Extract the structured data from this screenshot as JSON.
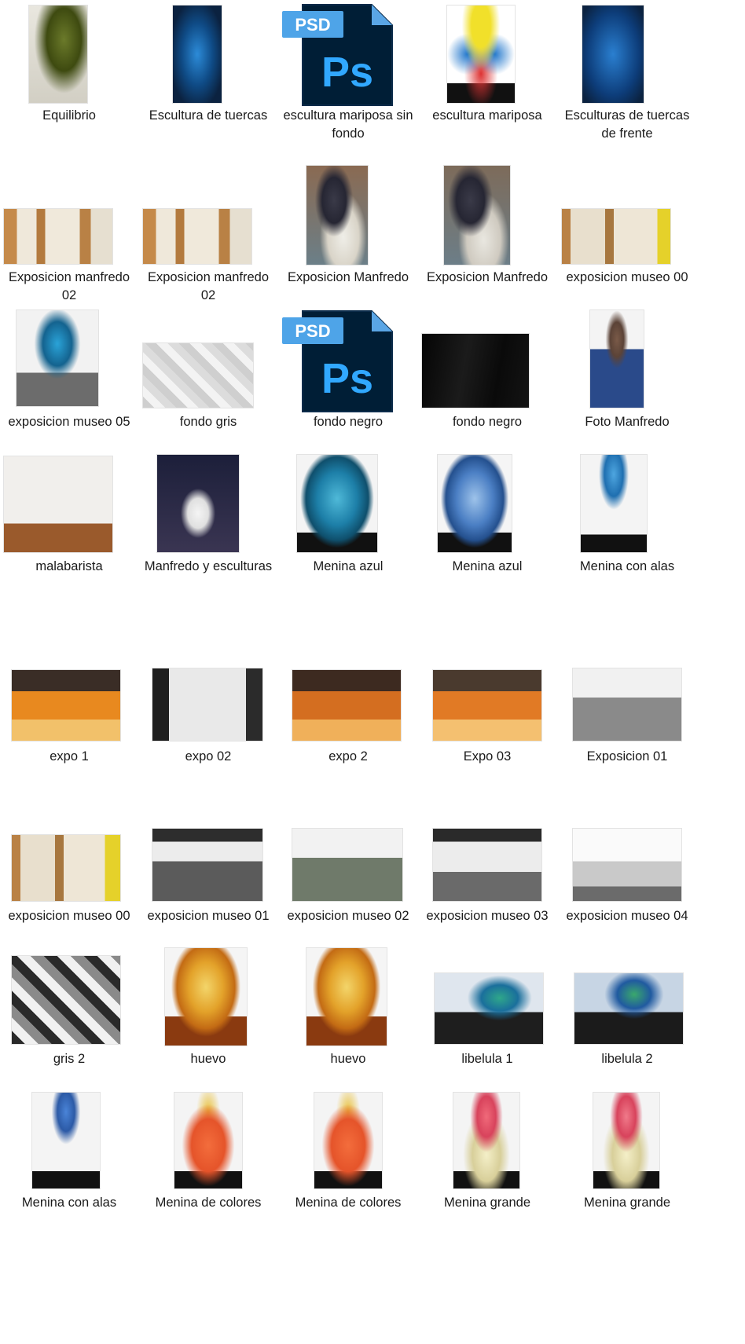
{
  "files": [
    {
      "label": "Equilibrio",
      "type": "image",
      "icon": "sculpture-thumbnail"
    },
    {
      "label": "Escultura de tuercas",
      "type": "image",
      "icon": "sculpture-thumbnail"
    },
    {
      "label": "escultura mariposa sin fondo",
      "type": "psd",
      "icon": "photoshop-file-icon",
      "psd_badge": "PSD",
      "ps_letters": "Ps"
    },
    {
      "label": "escultura mariposa",
      "type": "image",
      "icon": "sculpture-thumbnail"
    },
    {
      "label": "Esculturas de tuercas de frente",
      "type": "image",
      "icon": "sculpture-thumbnail"
    },
    {
      "label": "Exposicion manfredo 02",
      "type": "image",
      "icon": "gallery-thumbnail"
    },
    {
      "label": "Exposicion manfredo 02",
      "type": "image",
      "icon": "gallery-thumbnail"
    },
    {
      "label": "Exposicion Manfredo",
      "type": "image",
      "icon": "portrait-thumbnail"
    },
    {
      "label": "Exposicion Manfredo",
      "type": "image",
      "icon": "portrait-thumbnail"
    },
    {
      "label": "exposicion museo 00",
      "type": "image",
      "icon": "gallery-thumbnail"
    },
    {
      "label": "exposicion museo 05",
      "type": "image",
      "icon": "sculpture-thumbnail"
    },
    {
      "label": "fondo gris",
      "type": "image",
      "icon": "background-thumbnail"
    },
    {
      "label": "fondo negro",
      "type": "psd",
      "icon": "photoshop-file-icon",
      "psd_badge": "PSD",
      "ps_letters": "Ps"
    },
    {
      "label": "fondo negro",
      "type": "image",
      "icon": "background-thumbnail"
    },
    {
      "label": "Foto Manfredo",
      "type": "image",
      "icon": "portrait-thumbnail"
    },
    {
      "label": "malabarista",
      "type": "image",
      "icon": "sculpture-thumbnail"
    },
    {
      "label": "Manfredo y esculturas",
      "type": "image",
      "icon": "portrait-thumbnail"
    },
    {
      "label": "Menina azul",
      "type": "image",
      "icon": "sculpture-thumbnail"
    },
    {
      "label": "Menina azul",
      "type": "image",
      "icon": "sculpture-thumbnail"
    },
    {
      "label": "Menina con alas",
      "type": "image",
      "icon": "sculpture-thumbnail"
    },
    {
      "label": "expo 1",
      "type": "image",
      "icon": "gallery-thumbnail"
    },
    {
      "label": "expo 02",
      "type": "image",
      "icon": "gallery-thumbnail"
    },
    {
      "label": "expo 2",
      "type": "image",
      "icon": "gallery-thumbnail"
    },
    {
      "label": "Expo 03",
      "type": "image",
      "icon": "gallery-thumbnail"
    },
    {
      "label": "Exposicion 01",
      "type": "image",
      "icon": "gallery-thumbnail"
    },
    {
      "label": "exposicion museo 00",
      "type": "image",
      "icon": "gallery-thumbnail"
    },
    {
      "label": "exposicion museo 01",
      "type": "image",
      "icon": "gallery-thumbnail"
    },
    {
      "label": "exposicion museo 02",
      "type": "image",
      "icon": "gallery-thumbnail"
    },
    {
      "label": "exposicion museo 03",
      "type": "image",
      "icon": "gallery-thumbnail"
    },
    {
      "label": "exposicion museo 04",
      "type": "image",
      "icon": "gallery-thumbnail"
    },
    {
      "label": "gris 2",
      "type": "image",
      "icon": "background-thumbnail"
    },
    {
      "label": "huevo",
      "type": "image",
      "icon": "sculpture-thumbnail"
    },
    {
      "label": "huevo",
      "type": "image",
      "icon": "sculpture-thumbnail"
    },
    {
      "label": "libelula 1",
      "type": "image",
      "icon": "sculpture-thumbnail"
    },
    {
      "label": "libelula 2",
      "type": "image",
      "icon": "sculpture-thumbnail"
    },
    {
      "label": "Menina con alas",
      "type": "image",
      "icon": "sculpture-thumbnail"
    },
    {
      "label": "Menina de colores",
      "type": "image",
      "icon": "sculpture-thumbnail"
    },
    {
      "label": "Menina de colores",
      "type": "image",
      "icon": "sculpture-thumbnail"
    },
    {
      "label": "Menina grande",
      "type": "image",
      "icon": "sculpture-thumbnail"
    },
    {
      "label": "Menina grande",
      "type": "image",
      "icon": "sculpture-thumbnail"
    }
  ],
  "colors": {
    "psd_dark": "#001e36",
    "psd_blue": "#31a8ff",
    "label_text": "#1a1a1a"
  }
}
